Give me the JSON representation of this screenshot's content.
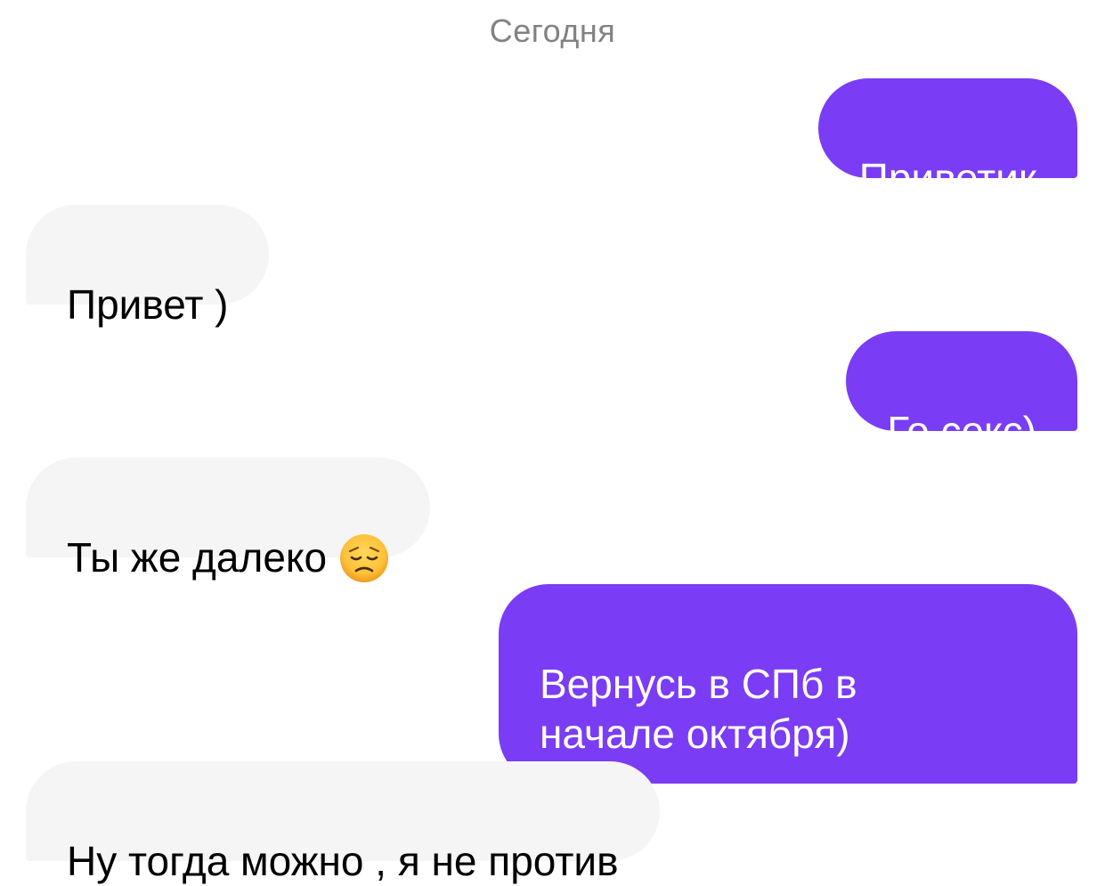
{
  "chat": {
    "date_label": "Сегодня",
    "messages": [
      {
        "direction": "outgoing",
        "text": "Приветик"
      },
      {
        "direction": "incoming",
        "text": "Привет )"
      },
      {
        "direction": "outgoing",
        "text": "Го секс)"
      },
      {
        "direction": "incoming",
        "text": "Ты же далеко",
        "emoji": "disappointed-face-icon"
      },
      {
        "direction": "outgoing",
        "text": "Вернусь в СПб в\nначале октября)"
      },
      {
        "direction": "incoming",
        "text": "Ну тогда можно , я не против"
      }
    ]
  },
  "colors": {
    "outgoing_bubble": "#7a3cf4",
    "incoming_bubble": "#f5f5f5",
    "date_label": "#828282"
  }
}
